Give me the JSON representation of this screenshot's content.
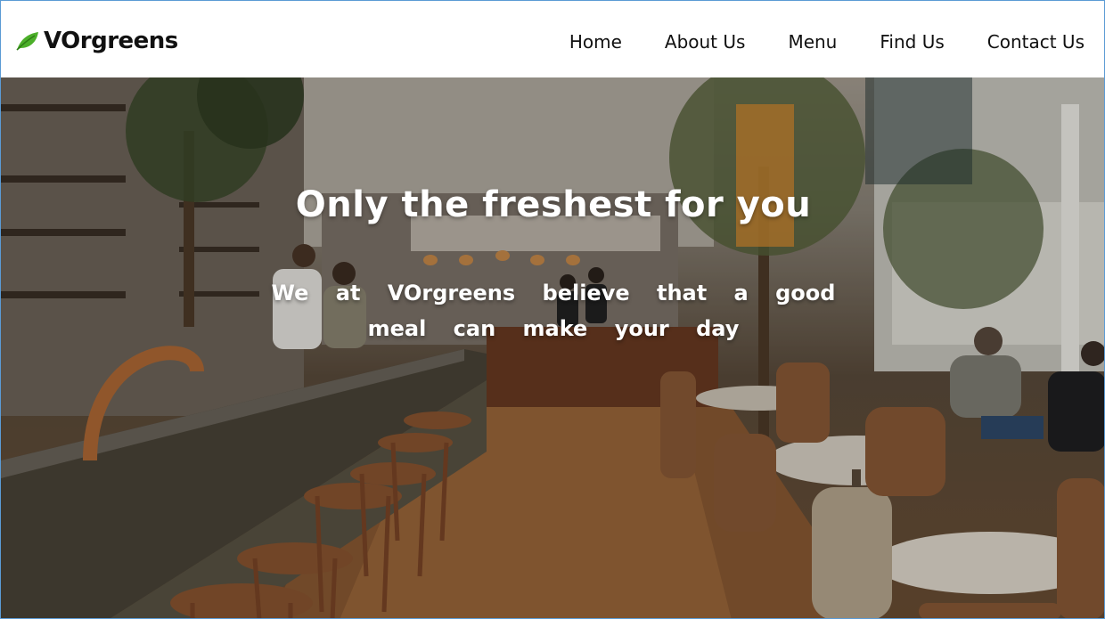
{
  "brand": {
    "name": "VOrgreens",
    "icon": "leaf-icon",
    "accent": "#4caf2a"
  },
  "nav": {
    "items": [
      {
        "label": "Home"
      },
      {
        "label": "About Us"
      },
      {
        "label": "Menu"
      },
      {
        "label": "Find Us"
      },
      {
        "label": "Contact Us"
      }
    ]
  },
  "hero": {
    "headline": "Only the freshest for you",
    "tagline": "We at VOrgreens believe that a good meal can make your day",
    "image": "restaurant-interior-photo"
  }
}
